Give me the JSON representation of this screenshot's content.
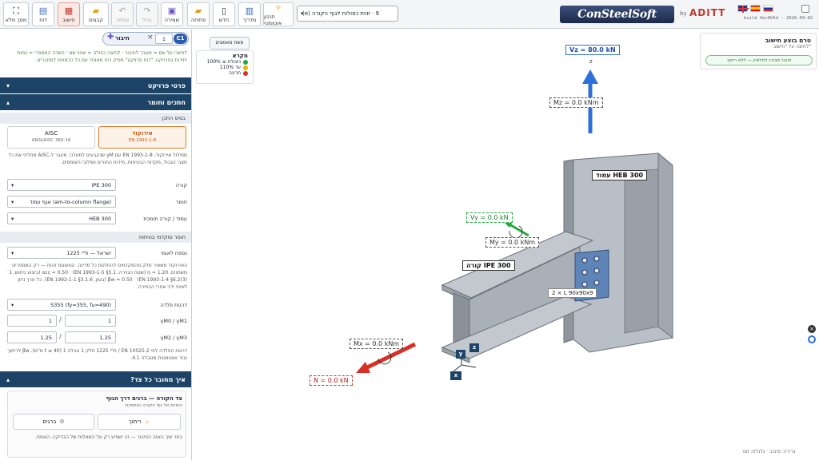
{
  "header": {
    "full_view": "מסך מלא",
    "report": "דוח",
    "compute": "חישוב",
    "connections": "קבצים",
    "undo": "בטל",
    "redo": "שחזור",
    "save": "שמירה",
    "open": "פתיחה",
    "new": "חדש",
    "guide": "מדריך",
    "auto_design": "תכנון אוטומטי",
    "connection_select": "9 · זווית כפולות לגוף הקורה (e)",
    "logo": "ConSteelSoft",
    "by": "by",
    "aditt": "ADITT",
    "build": "build 4ec0b5d · 2026-09-02"
  },
  "sidebar": {
    "c1_badge": "C1",
    "c1_count": "1",
    "connect_label": "חיבור",
    "hint": "לחיצה על שם = מעבר לחיבור · לחיצה כפולה = שינוי שם · השדה המספרי = כמות יחידות בפרויקט. \"דוח פרויקט\" מפיק דוח מאוחד עם כל הכמויות למחברים.",
    "project_details": "פרטי פרויקט",
    "profiles_material": "חתכים וחומר",
    "design_basis": "בסיס התכן",
    "code_eurocode": "אירוקוד",
    "code_eurocode_sub": "EN 1993-1-8",
    "code_aisc": "AISC",
    "code_aisc_sub": "ANSI/AISC 360-16",
    "code_note": "מסילול אירוקוד: EN 1993-1-8 עם γM שנקבעים למעלה. מעבר ל-AISC מחליף את כל מצבי הגבול, מקדמי הבטיחות, מידות החורים ושילובי העומסים.",
    "beam_label": "קורה",
    "beam_value": "IPE 300",
    "connection_label": "חומר",
    "connection_value": "אגף עמוד (am-to-column flange)",
    "column_label": "עמוד / קורה תומכת",
    "column_value": "HEB 300",
    "materials_header": "חומר ומקדמי בטיחות",
    "annex_label": "נספח לאומי",
    "annex_value": "ישראל — ת\"י 1225",
    "annex_note": "האירוקוד משאיר חלק מהמקדמים להחלטת כל מדינה. הטעונות זהות — רק המספרים משתנים. 1.20 = η (שטח הגזירה, EN 1993-1-5 §5.1) · αcc = 0.50 (ביצוע ניחוש, 1 · EN 1993-1-4 §6.2(3)) · βw = 0.50 (בטון, EN 1992-1-1 §3.1.6). כל ערך ניתן לשינוי ידני אחרי הבחירה.",
    "plate_grade_label": "דרגות פלדה",
    "plate_grade_value": "S355 (fy=355, fu=490)",
    "gamma_m0_label": "γM0 / γM1",
    "gamma_m0": "1",
    "gamma_m1": "1",
    "gamma_m2_label": "γM2 / γM3",
    "gamma_m2": "1.25",
    "gamma_m3": "1.25",
    "steel_note": "דרגות הפלדה לפי EN 10025-2 / ת\"י 1225 חלק 1 טבלה 1 (40 ≥ t מ\"מ). βw לריתוך נגזר אוטומטית מטבלה 4.1.",
    "how_connected": "איך מחובר כל צד?",
    "beam_side_title": "צד הקורה — ברגים דרך הגוף",
    "beam_side_sub": "הזוויות אל גוף הקורה הנתמכת",
    "weld_btn": "ריתוך",
    "bolts_btn": "ברגים",
    "beam_side_note": "בחר איך האזה החיבור — זה ישפיע רק על השאלות של הבדיקה. האמת."
  },
  "viewport": {
    "loads_button": "משת מאמצים",
    "legend_title": "מקרא",
    "legend_items": [
      "ניצולת ≤ 100%",
      "עד 110%",
      "חריגה"
    ],
    "calc_title": "טרם בוצע חישוב",
    "calc_sub": "לחיצה על \"חישוב\"",
    "calc_badge": "חיבור מבורג לחלוטין — ללא ריתוך",
    "vz": "Vz = 80.0 kN",
    "z_axis": "z",
    "mz": "Mz = 0.0 kNm",
    "column_tag": "עמוד HEB 300",
    "beam_tag": "קורה IPE 300",
    "vy": "Vy = 0.0 kN",
    "my": "My = 0.0 kNm",
    "angle_tag": "2 × L 90x90x9",
    "mx": "Mx = 0.0 kNm",
    "n": "N = 0.0 kN",
    "ax_z": "z",
    "ax_y": "y",
    "ax_x": "x",
    "footer": "גרירה: סיבוב · גלגלת: זום"
  },
  "colors": {
    "navy": "#1d4466",
    "orange": "#e07a27",
    "green": "#26a641",
    "red": "#d93025",
    "blue": "#2f6fdb",
    "amber": "#f0b400"
  }
}
